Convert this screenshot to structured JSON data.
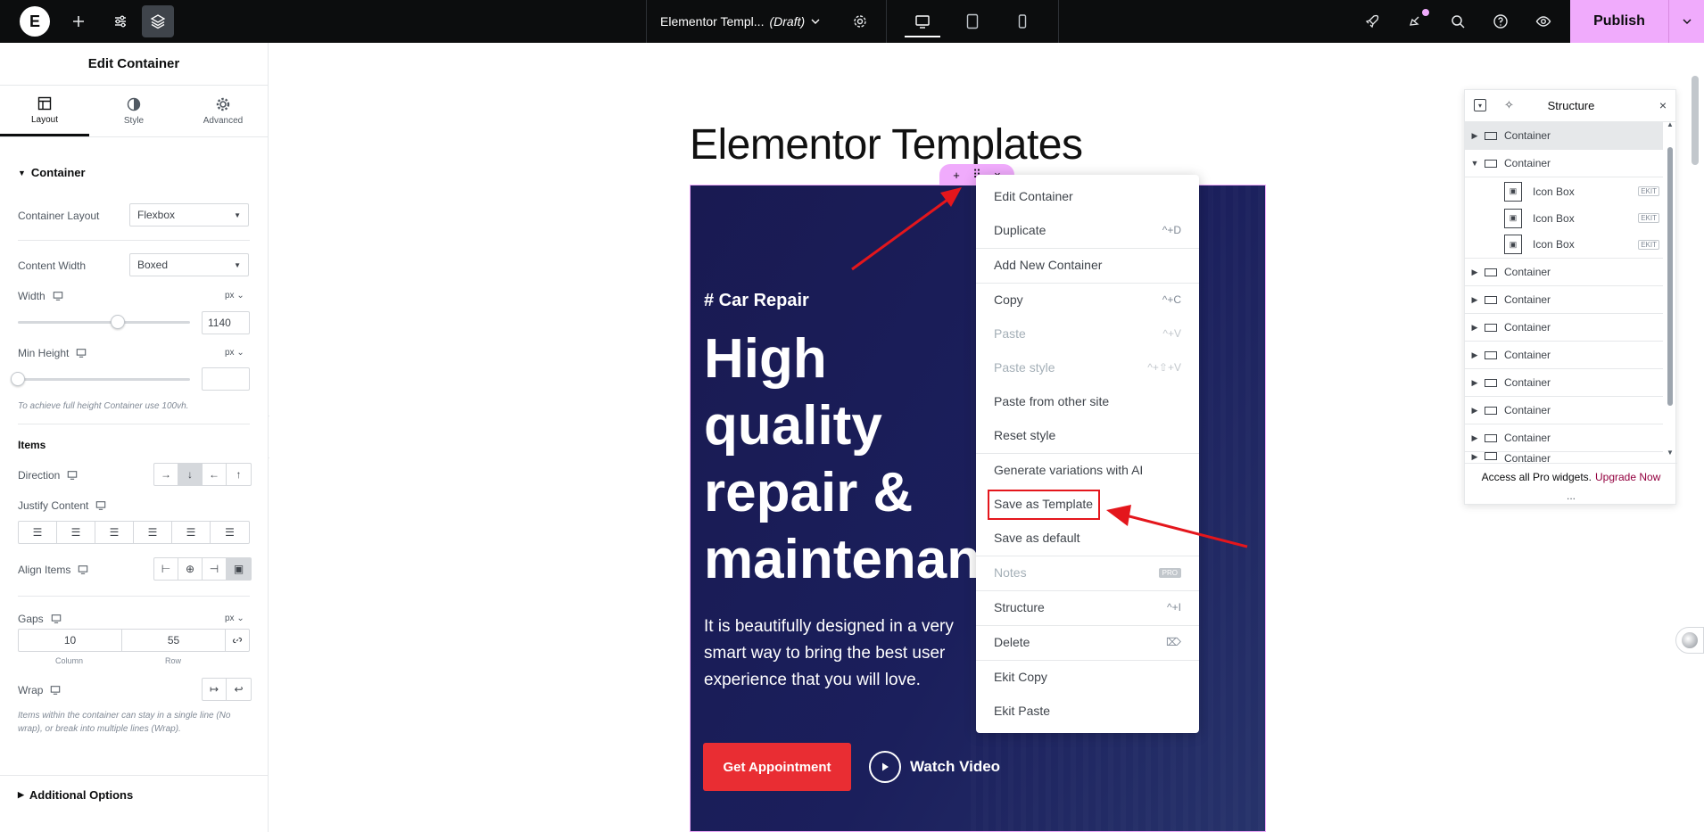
{
  "topbar": {
    "doc_title": "Elementor Templ...",
    "doc_status": "(Draft)",
    "publish_label": "Publish"
  },
  "panel": {
    "title": "Edit Container",
    "tabs": [
      {
        "label": "Layout",
        "icon": "layout-icon"
      },
      {
        "label": "Style",
        "icon": "style-half-circle-icon"
      },
      {
        "label": "Advanced",
        "icon": "gear-icon"
      }
    ],
    "section_container": "Container",
    "container_layout_label": "Container Layout",
    "container_layout_value": "Flexbox",
    "content_width_label": "Content Width",
    "content_width_value": "Boxed",
    "width_label": "Width",
    "width_unit": "px",
    "width_value": "1140",
    "width_slider_fraction": 0.58,
    "min_height_label": "Min Height",
    "min_height_unit": "px",
    "min_height_value": "",
    "min_height_hint": "To achieve full height Container use 100vh.",
    "items_heading": "Items",
    "direction_label": "Direction",
    "justify_label": "Justify Content",
    "align_label": "Align Items",
    "gaps_label": "Gaps",
    "gaps_unit": "px",
    "gap_column": "10",
    "gap_row": "55",
    "gap_column_label": "Column",
    "gap_row_label": "Row",
    "wrap_label": "Wrap",
    "wrap_hint": "Items within the container can stay in a single line (No wrap), or break into multiple lines (Wrap).",
    "additional_options": "Additional Options"
  },
  "canvas": {
    "page_heading": "Elementor Templates",
    "hero_tag": "# Car Repair",
    "hero_title_lines": [
      "High",
      "quality",
      "repair &",
      "maintenan"
    ],
    "hero_text": "It is beautifully designed in a very smart way to bring the best user experience that you will love.",
    "btn_appointment": "Get Appointment",
    "btn_watch": "Watch Video"
  },
  "context_menu": {
    "items": [
      {
        "label": "Edit Container",
        "shortcut": "",
        "disabled": false
      },
      {
        "label": "Duplicate",
        "shortcut": "^+D",
        "disabled": false
      },
      {
        "label": "Add New Container",
        "shortcut": "",
        "disabled": false
      },
      {
        "label": "Copy",
        "shortcut": "^+C",
        "disabled": false
      },
      {
        "label": "Paste",
        "shortcut": "^+V",
        "disabled": true
      },
      {
        "label": "Paste style",
        "shortcut": "^+⇧+V",
        "disabled": true
      },
      {
        "label": "Paste from other site",
        "shortcut": "",
        "disabled": false
      },
      {
        "label": "Reset style",
        "shortcut": "",
        "disabled": false
      },
      {
        "label": "Generate variations with AI",
        "shortcut": "",
        "disabled": false
      },
      {
        "label": "Save as Template",
        "shortcut": "",
        "disabled": false
      },
      {
        "label": "Save as default",
        "shortcut": "",
        "disabled": false
      },
      {
        "label": "Notes",
        "shortcut": "PRO",
        "disabled": true
      },
      {
        "label": "Structure",
        "shortcut": "^+I",
        "disabled": false
      },
      {
        "label": "Delete",
        "shortcut": "⌦",
        "disabled": false
      },
      {
        "label": "Ekit Copy",
        "shortcut": "",
        "disabled": false
      },
      {
        "label": "Ekit Paste",
        "shortcut": "",
        "disabled": false
      }
    ]
  },
  "structure": {
    "title": "Structure",
    "rows": [
      {
        "label": "Container",
        "level": 0,
        "expanded": false,
        "selected": true
      },
      {
        "label": "Container",
        "level": 0,
        "expanded": true,
        "selected": false
      },
      {
        "label": "Icon Box",
        "level": 1,
        "badge": "EKIT"
      },
      {
        "label": "Icon Box",
        "level": 1,
        "badge": "EKIT"
      },
      {
        "label": "Icon Box",
        "level": 1,
        "badge": "EKIT"
      },
      {
        "label": "Container",
        "level": 0,
        "expanded": false
      },
      {
        "label": "Container",
        "level": 0,
        "expanded": false
      },
      {
        "label": "Container",
        "level": 0,
        "expanded": false
      },
      {
        "label": "Container",
        "level": 0,
        "expanded": false
      },
      {
        "label": "Container",
        "level": 0,
        "expanded": false
      },
      {
        "label": "Container",
        "level": 0,
        "expanded": false
      },
      {
        "label": "Container",
        "level": 0,
        "expanded": false
      },
      {
        "label": "Container",
        "level": 0,
        "expanded": false
      }
    ],
    "footer_text": "Access all Pro widgets.",
    "footer_link": "Upgrade Now",
    "more": "..."
  },
  "colors": {
    "accent_pink": "#f0abfc",
    "topbar_bg": "#0c0d0e",
    "hero_bg": "#191a52",
    "cta_red": "#e92d33",
    "annotation_red": "#e4161c"
  }
}
